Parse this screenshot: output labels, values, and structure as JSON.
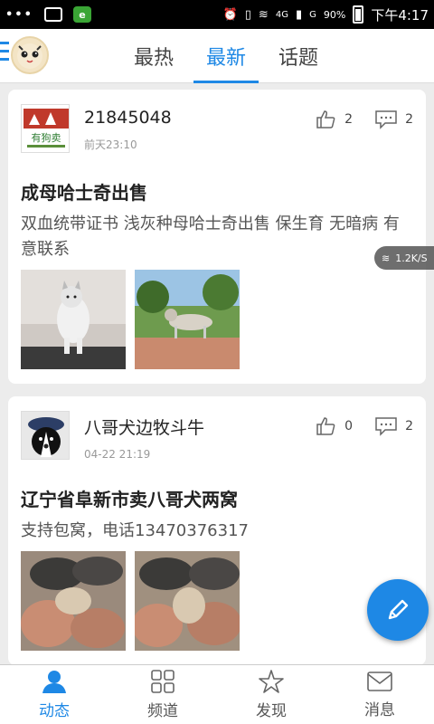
{
  "statusbar": {
    "dots": "•••",
    "wechat_badge": "e",
    "network_type": "4G",
    "network_type2": "G",
    "battery": "90%",
    "time": "下午4:17"
  },
  "topnav": {
    "tabs": [
      {
        "label": "最热"
      },
      {
        "label": "最新"
      },
      {
        "label": "话题"
      }
    ]
  },
  "speed_badge": "1.2K/S",
  "posts": [
    {
      "username": "21845048",
      "time": "前天23:10",
      "likes": "2",
      "comments": "2",
      "title": "成母哈士奇出售",
      "body": "双血统带证书 浅灰种母哈士奇出售 保生育 无暗病 有意联系",
      "avatar_text": "有狗卖"
    },
    {
      "username": "八哥犬边牧斗牛",
      "time": "04-22 21:19",
      "likes": "0",
      "comments": "2",
      "title": "辽宁省阜新市卖八哥犬两窝",
      "body": "支持包窝，电话13470376317"
    }
  ],
  "bottomnav": {
    "items": [
      {
        "label": "动态"
      },
      {
        "label": "频道"
      },
      {
        "label": "发现"
      },
      {
        "label": "消息"
      }
    ]
  },
  "colors": {
    "accent": "#1e88e5",
    "background": "#ececec"
  }
}
